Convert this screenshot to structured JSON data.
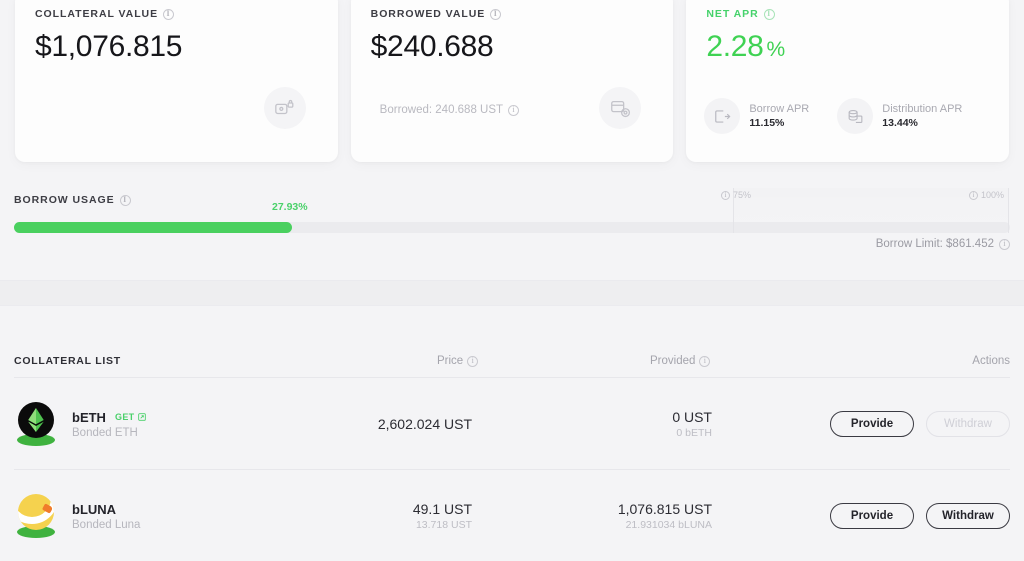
{
  "cards": [
    {
      "label": "COLLATERAL VALUE",
      "value": "$1,076.815",
      "icon": "vault-lock-icon"
    },
    {
      "label": "BORROWED VALUE",
      "value": "$240.688",
      "sub": "Borrowed: 240.688 UST",
      "icon": "calendar-coin-icon"
    },
    {
      "label": "NET APR",
      "value": "2.28",
      "unit": "%",
      "accent": "#3fd253",
      "stats": [
        {
          "name": "Borrow APR",
          "value": "11.15%",
          "icon": "box-arrow-out-icon"
        },
        {
          "name": "Distribution APR",
          "value": "13.44%",
          "icon": "coin-stack-icon"
        }
      ]
    }
  ],
  "usage": {
    "label": "BORROW USAGE",
    "percent_text": "27.93%",
    "percent_value": 27.93,
    "fill_color": "#4ad05f",
    "ticks": [
      {
        "label": "75%",
        "position": 75
      },
      {
        "label": "100%",
        "position": 100
      }
    ],
    "borrow_limit": "Borrow Limit: $861.452"
  },
  "collateral": {
    "title": "COLLATERAL LIST",
    "columns": {
      "price": "Price",
      "provided": "Provided",
      "actions": "Actions"
    },
    "rows": [
      {
        "symbol": "bETH",
        "name": "Bonded ETH",
        "badge": "GET",
        "icon": "beth-token-icon",
        "price_main": "2,602.024 UST",
        "price_sub": "",
        "provided_main": "0 UST",
        "provided_sub": "0 bETH",
        "provide_label": "Provide",
        "withdraw_label": "Withdraw",
        "withdraw_disabled": true
      },
      {
        "symbol": "bLUNA",
        "name": "Bonded Luna",
        "badge": "",
        "icon": "bluna-token-icon",
        "price_main": "49.1 UST",
        "price_sub": "13.718 UST",
        "provided_main": "1,076.815 UST",
        "provided_sub": "21.931034 bLUNA",
        "provide_label": "Provide",
        "withdraw_label": "Withdraw",
        "withdraw_disabled": false
      }
    ]
  }
}
